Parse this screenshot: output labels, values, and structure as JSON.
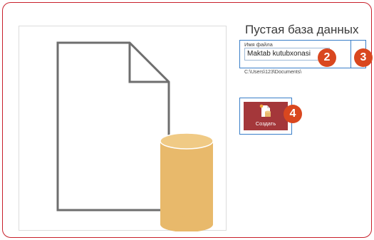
{
  "panel": {
    "title": "Пустая база данных",
    "file_name_label": "Имя файла",
    "file_name_value": "Maktab kutubxonasi",
    "file_path": "C:\\Users\\123\\Documents\\",
    "create_label": "Создать"
  },
  "callouts": [
    "2",
    "3",
    "4"
  ],
  "colors": {
    "frame_border": "#c8202b",
    "highlight_blue": "#3a7fc9",
    "create_button": "#a4373a",
    "badge": "#d9471f",
    "cylinder": "#e8b96b"
  },
  "icons": {
    "browse": "folder-icon",
    "create": "new-database-icon",
    "preview": "blank-database-illustration"
  }
}
